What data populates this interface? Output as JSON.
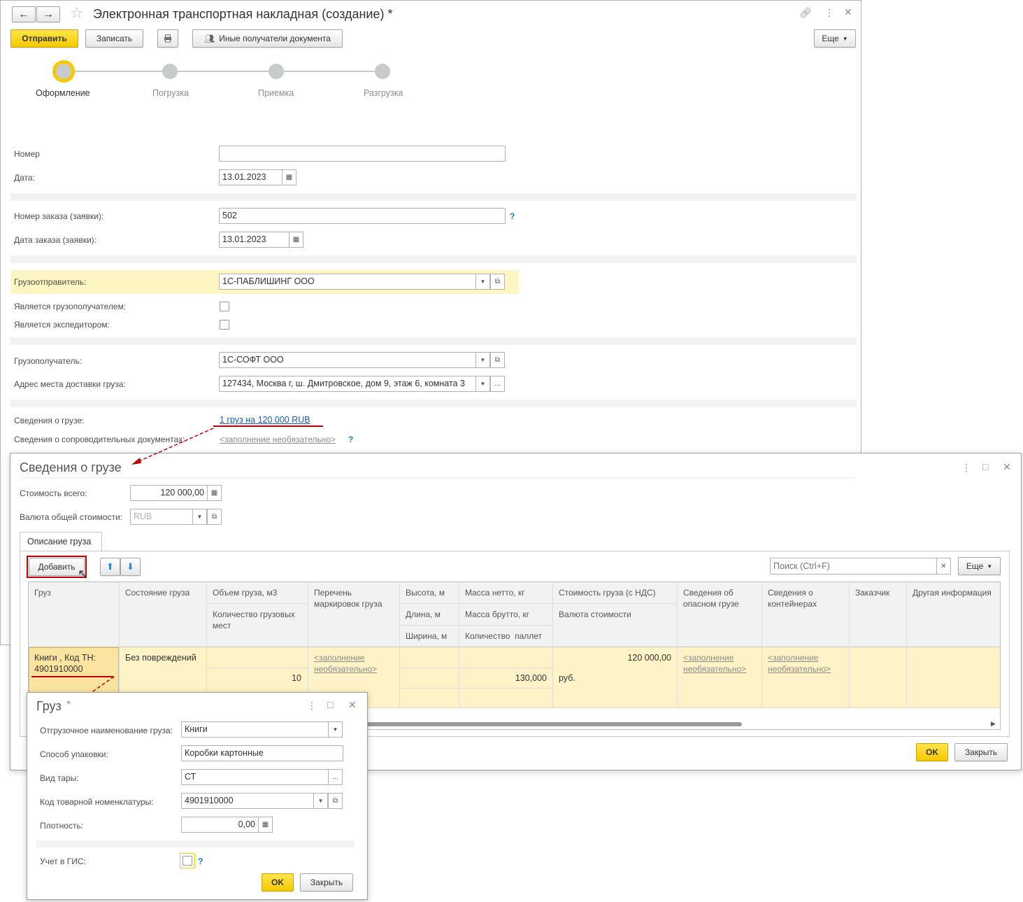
{
  "main": {
    "title": "Электронная транспортная накладная (создание) *",
    "toolbar": {
      "send": "Отправить",
      "save": "Записать",
      "other_recipients": "Иные получатели документа",
      "more": "Еще"
    },
    "steps": [
      "Оформление",
      "Погрузка",
      "Приемка",
      "Разгрузка"
    ],
    "fields": {
      "number_label": "Номер",
      "number_value": "",
      "date_label": "Дата:",
      "date_value": "13.01.2023",
      "order_number_label": "Номер заказа (заявки):",
      "order_number_value": "502",
      "order_date_label": "Дата заказа (заявки):",
      "order_date_value": "13.01.2023",
      "shipper_label": "Грузоотправитель:",
      "shipper_value": "1С-ПАБЛИШИНГ ООО",
      "is_consignee_label": "Является грузополучателем:",
      "is_forwarder_label": "Является экспедитором:",
      "consignee_label": "Грузополучатель:",
      "consignee_value": "1С-СОФТ ООО",
      "address_label": "Адрес места доставки груза:",
      "address_value": "127434, Москва г, ш. Дмитровское, дом 9, этаж 6, комната 3",
      "cargo_info_label": "Сведения о грузе:",
      "cargo_info_link": "1 груз на 120 000 RUB",
      "docs_label": "Сведения о сопроводительных документах:",
      "docs_link": "<заполнение необязательно>",
      "help": "?"
    }
  },
  "cargo_dialog": {
    "title": "Сведения о грузе",
    "total_cost_label": "Стоимость всего:",
    "total_cost_value": "120 000,00",
    "currency_label": "Валюта общей стоимости:",
    "currency_value": "RUB",
    "tab": "Описание груза",
    "add": "Добавить",
    "search_placeholder": "Поиск (Ctrl+F)",
    "more": "Еще",
    "columns": {
      "cargo": "Груз",
      "state": "Состояние груза",
      "volume": "Объем груза, м3",
      "places": "Количество грузовых мест",
      "markings": "Перечень маркировок груза",
      "height": "Высота, м",
      "length": "Длина, м",
      "width": "Ширина, м",
      "net": "Масса нетто, кг",
      "gross": "Масса брутто, кг",
      "pallets": "Количество  паллет",
      "cost": "Стоимость груза (с НДС)",
      "currency": "Валюта стоимости",
      "dangerous": "Сведения об опасном грузе",
      "containers": "Сведения о контейнерах",
      "customer": "Заказчик",
      "other": "Другая информация"
    },
    "row": {
      "cargo": "Книги , Код ТН: 4901910000",
      "state": "Без повреждений",
      "places": "10",
      "markings": "<заполнение необязательно>",
      "gross": "130,000",
      "cost": "120 000,00",
      "currency": "руб.",
      "dangerous": "<заполнение необязательно>",
      "containers": "<заполнение необязательно>"
    },
    "ok": "OK",
    "close": "Закрыть"
  },
  "gruz_dialog": {
    "title": "Груз",
    "title_mark": "*",
    "shipping_name_label": "Отгрузочное наименование груза:",
    "shipping_name_value": "Книги",
    "packing_label": "Способ упаковки:",
    "packing_value": "Коробки картонные",
    "tare_label": "Вид тары:",
    "tare_value": "СТ",
    "code_label": "Код товарной номенклатуры:",
    "code_value": "4901910000",
    "density_label": "Плотность:",
    "density_value": "0,00",
    "gis_label": "Учет в ГИС:",
    "help": "?",
    "ok": "OK",
    "close": "Закрыть"
  },
  "colors": {
    "accent_yellow": "#f5c800",
    "highlight_row": "#fdf3c6",
    "annotation_red": "#c00000",
    "link_blue": "#1f5aa8"
  }
}
